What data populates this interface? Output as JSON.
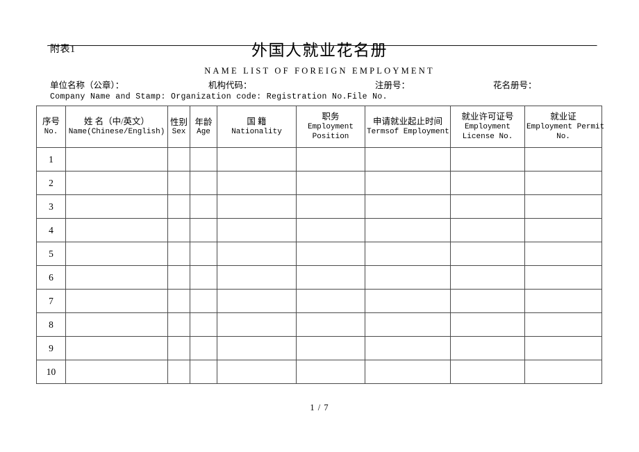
{
  "document": {
    "attachment_label": "附表1",
    "title_cn": "外国人就业花名册",
    "title_en": "NAME LIST OF FOREIGN EMPLOYMENT",
    "page_footer": "1 / 7"
  },
  "fields": {
    "company_cn": "单位名称（公章）：",
    "org_code_cn": "机构代码：",
    "reg_no_cn": "注册号：",
    "roll_no_cn": "花名册号：",
    "english_line": "Company Name and Stamp: Organization code: Registration No.File No."
  },
  "table": {
    "columns": [
      {
        "cn": "序号",
        "en": "No.",
        "en2": ""
      },
      {
        "cn": "姓  名（中/英文）",
        "en": "Name(Chinese/English)",
        "en2": ""
      },
      {
        "cn": "性别",
        "en": "Sex",
        "en2": ""
      },
      {
        "cn": "年龄",
        "en": "Age",
        "en2": ""
      },
      {
        "cn": "国  籍",
        "en": "Nationality",
        "en2": ""
      },
      {
        "cn": "职务",
        "en": "Employment",
        "en2": "Position"
      },
      {
        "cn": "申请就业起止时间",
        "en": "Termsof Employment",
        "en2": ""
      },
      {
        "cn": "就业许可证号",
        "en": "Employment",
        "en2": "License No."
      },
      {
        "cn": "就业证",
        "en": "Employment Permit",
        "en2": "No."
      }
    ],
    "rows": [
      {
        "no": "1",
        "name": "",
        "sex": "",
        "age": "",
        "nationality": "",
        "position": "",
        "terms": "",
        "license_no": "",
        "permit_no": ""
      },
      {
        "no": "2",
        "name": "",
        "sex": "",
        "age": "",
        "nationality": "",
        "position": "",
        "terms": "",
        "license_no": "",
        "permit_no": ""
      },
      {
        "no": "3",
        "name": "",
        "sex": "",
        "age": "",
        "nationality": "",
        "position": "",
        "terms": "",
        "license_no": "",
        "permit_no": ""
      },
      {
        "no": "4",
        "name": "",
        "sex": "",
        "age": "",
        "nationality": "",
        "position": "",
        "terms": "",
        "license_no": "",
        "permit_no": ""
      },
      {
        "no": "5",
        "name": "",
        "sex": "",
        "age": "",
        "nationality": "",
        "position": "",
        "terms": "",
        "license_no": "",
        "permit_no": ""
      },
      {
        "no": "6",
        "name": "",
        "sex": "",
        "age": "",
        "nationality": "",
        "position": "",
        "terms": "",
        "license_no": "",
        "permit_no": ""
      },
      {
        "no": "7",
        "name": "",
        "sex": "",
        "age": "",
        "nationality": "",
        "position": "",
        "terms": "",
        "license_no": "",
        "permit_no": ""
      },
      {
        "no": "8",
        "name": "",
        "sex": "",
        "age": "",
        "nationality": "",
        "position": "",
        "terms": "",
        "license_no": "",
        "permit_no": ""
      },
      {
        "no": "9",
        "name": "",
        "sex": "",
        "age": "",
        "nationality": "",
        "position": "",
        "terms": "",
        "license_no": "",
        "permit_no": ""
      },
      {
        "no": "10",
        "name": "",
        "sex": "",
        "age": "",
        "nationality": "",
        "position": "",
        "terms": "",
        "license_no": "",
        "permit_no": ""
      }
    ]
  }
}
